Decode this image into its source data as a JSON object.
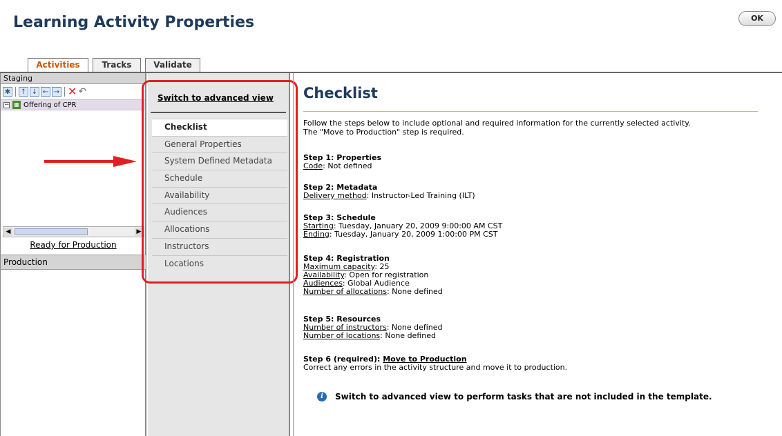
{
  "header": {
    "title": "Learning Activity Properties",
    "ok_label": "OK"
  },
  "tabs": [
    "Activities",
    "Tracks",
    "Validate"
  ],
  "staging": {
    "header": "Staging",
    "tree_item": "Offering of CPR",
    "ready_link": "Ready for Production"
  },
  "production": {
    "header": "Production"
  },
  "middle": {
    "switch_link": "Switch to advanced view",
    "menu": [
      "Checklist",
      "General Properties",
      "System Defined Metadata",
      "Schedule",
      "Availability",
      "Audiences",
      "Allocations",
      "Instructors",
      "Locations"
    ]
  },
  "content": {
    "title": "Checklist",
    "intro_1": "Follow the steps below to include optional and required information for the currently selected activity.",
    "intro_2": "The \"Move to Production\" step is required.",
    "step1": {
      "heading": "Step 1: Properties",
      "code_label": "Code",
      "code_value": ": Not defined"
    },
    "step2": {
      "heading": "Step 2: Metadata",
      "label": "Delivery method",
      "value": ": Instructor-Led Training (ILT)"
    },
    "step3": {
      "heading": "Step 3: Schedule",
      "start_label": "Starting",
      "start_value": ": Tuesday, January 20, 2009 9:00:00 AM CST",
      "end_label": "Ending",
      "end_value": ": Tuesday, January 20, 2009 1:00:00 PM CST"
    },
    "step4": {
      "heading": "Step 4: Registration",
      "cap_label": "Maximum capacity",
      "cap_value": ": 25",
      "avail_label": "Availability",
      "avail_value": ": Open for registration",
      "aud_label": "Audiences",
      "aud_value": ": Global Audience",
      "alloc_label": "Number of allocations",
      "alloc_value": ": None defined"
    },
    "step5": {
      "heading": "Step 5: Resources",
      "instr_label": "Number of instructors",
      "instr_value": ": None defined",
      "loc_label": "Number of locations",
      "loc_value": ": None defined"
    },
    "step6": {
      "heading": "Step 6 (required): ",
      "link": "Move to Production",
      "desc": "Correct any errors in the activity structure and move it to production."
    },
    "tip": "Switch to advanced view to perform tasks that are not included in the template."
  },
  "colors": {
    "accent": "#d35400",
    "title": "#1f3a5a",
    "annotation": "#e02020"
  }
}
